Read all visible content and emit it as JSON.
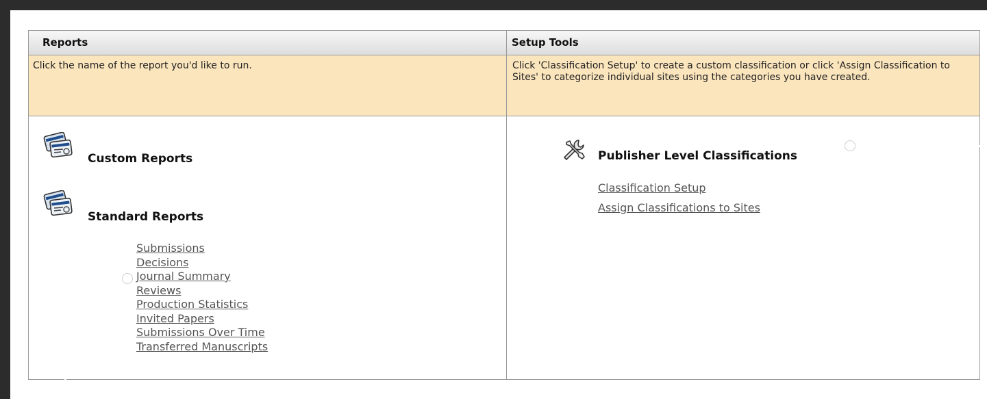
{
  "reports": {
    "header": "Reports",
    "description": "Click the name of the report you'd like to run.",
    "custom_reports_title": "Custom Reports",
    "standard_reports_title": "Standard Reports",
    "standard_reports": [
      "Submissions",
      "Decisions",
      "Journal Summary",
      "Reviews",
      "Production Statistics",
      "Invited Papers",
      "Submissions Over Time",
      "Transferred Manuscripts"
    ]
  },
  "setup_tools": {
    "header": "Setup Tools",
    "description": "Click 'Classification Setup' to create a custom classification or click 'Assign Classification to Sites' to categorize individual sites using the categories you have created.",
    "publisher_title": "Publisher Level Classifications",
    "links": [
      "Classification Setup",
      "Assign Classifications to Sites"
    ]
  },
  "icons": {
    "custom_reports": "report-cards-icon",
    "standard_reports": "report-cards-icon",
    "publisher": "wrench-icon"
  }
}
